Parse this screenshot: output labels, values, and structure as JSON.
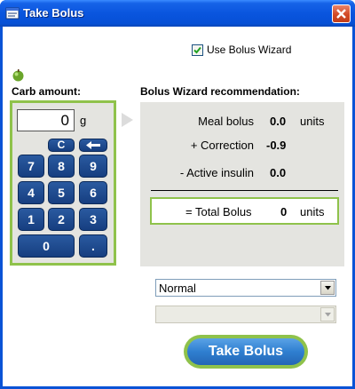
{
  "window": {
    "title": "Take Bolus",
    "accent": "#0a55de",
    "close_color": "#d24a26"
  },
  "wizard_toggle": {
    "label": "Use Bolus Wizard",
    "checked": true
  },
  "carb": {
    "heading": "Carb amount:",
    "value": "0",
    "unit": "g",
    "keys": {
      "clear": "C",
      "k7": "7",
      "k8": "8",
      "k9": "9",
      "k4": "4",
      "k5": "5",
      "k6": "6",
      "k1": "1",
      "k2": "2",
      "k3": "3",
      "k0": "0",
      "dot": "."
    }
  },
  "recommendation": {
    "heading": "Bolus Wizard recommendation:",
    "meal_label": "Meal bolus",
    "meal_value": "0.0",
    "meal_unit": "units",
    "correction_label": "+ Correction",
    "correction_value": "-0.9",
    "active_label": "- Active insulin",
    "active_value": "0.0",
    "total_label": "= Total Bolus",
    "total_value": "0",
    "total_unit": "units"
  },
  "bolus_type": {
    "selected": "Normal"
  },
  "secondary_select": {
    "selected": ""
  },
  "take_button": {
    "label": "Take Bolus"
  },
  "colors": {
    "green_frame": "#8fc24b",
    "key_blue": "#1f4f92",
    "panel_gray": "#e4e4e0"
  }
}
